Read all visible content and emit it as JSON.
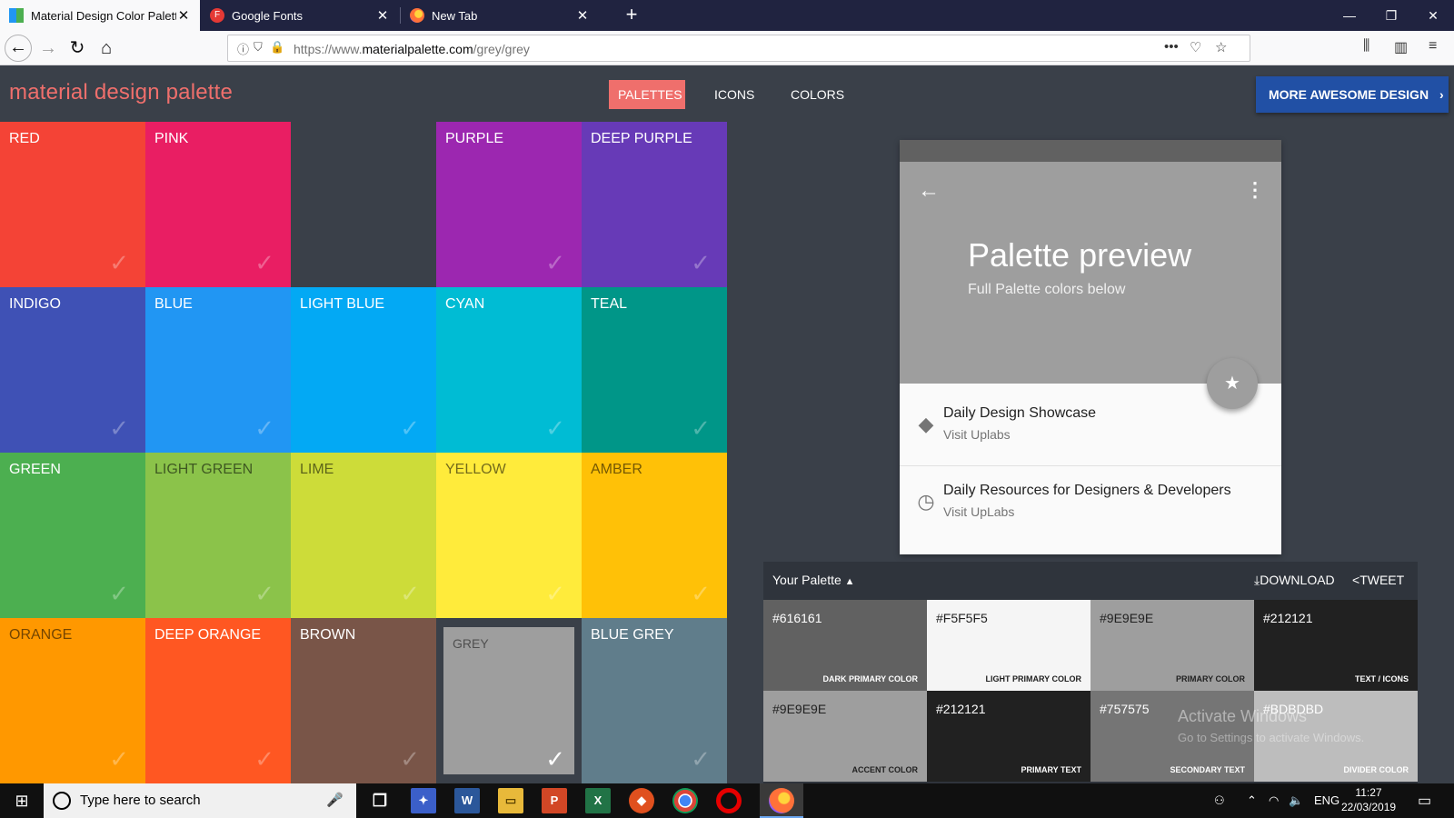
{
  "browser": {
    "tabs": [
      {
        "title": "Material Design Color Palette G",
        "favicon_color": "#2196f3"
      },
      {
        "title": "Google Fonts",
        "favicon_color": "#e53935"
      },
      {
        "title": "New Tab",
        "favicon_color": "#ff7139"
      }
    ],
    "url_prefix": "https://www.",
    "url_host": "materialpalette.com",
    "url_path": "/grey/grey"
  },
  "site": {
    "logo": "material design palette",
    "nav": [
      "PALETTES",
      "ICONS",
      "COLORS"
    ],
    "more_button": "MORE AWESOME DESIGN"
  },
  "colors": [
    {
      "name": "RED",
      "hex": "#f44336",
      "text": "light"
    },
    {
      "name": "PINK",
      "hex": "#e91e63",
      "text": "light"
    },
    {
      "name": "",
      "hex": "#3a4049",
      "text": "light",
      "empty": true
    },
    {
      "name": "PURPLE",
      "hex": "#9c27b0",
      "text": "light"
    },
    {
      "name": "DEEP PURPLE",
      "hex": "#673ab7",
      "text": "light"
    },
    {
      "name": "INDIGO",
      "hex": "#3f51b5",
      "text": "light"
    },
    {
      "name": "BLUE",
      "hex": "#2196f3",
      "text": "light"
    },
    {
      "name": "LIGHT BLUE",
      "hex": "#03a9f4",
      "text": "light"
    },
    {
      "name": "CYAN",
      "hex": "#00bcd4",
      "text": "light"
    },
    {
      "name": "TEAL",
      "hex": "#009688",
      "text": "light"
    },
    {
      "name": "GREEN",
      "hex": "#4caf50",
      "text": "light"
    },
    {
      "name": "LIGHT GREEN",
      "hex": "#8bc34a",
      "text": "dark"
    },
    {
      "name": "LIME",
      "hex": "#cddc39",
      "text": "dark"
    },
    {
      "name": "YELLOW",
      "hex": "#ffeb3b",
      "text": "dark"
    },
    {
      "name": "AMBER",
      "hex": "#ffc107",
      "text": "dark"
    },
    {
      "name": "ORANGE",
      "hex": "#ff9800",
      "text": "dark"
    },
    {
      "name": "DEEP ORANGE",
      "hex": "#ff5722",
      "text": "light"
    },
    {
      "name": "BROWN",
      "hex": "#795548",
      "text": "light"
    },
    {
      "name": "GREY",
      "hex": "#9e9e9e",
      "text": "dark",
      "selected": true
    },
    {
      "name": "BLUE GREY",
      "hex": "#607d8b",
      "text": "light"
    }
  ],
  "preview": {
    "title": "Palette preview",
    "subtitle": "Full Palette colors below",
    "items": [
      {
        "title": "Daily Design Showcase",
        "subtitle": "Visit Uplabs",
        "icon": "label-icon"
      },
      {
        "title": "Daily Resources for Designers & Developers",
        "subtitle": "Visit UpLabs",
        "icon": "clock-icon"
      }
    ]
  },
  "palette": {
    "title": "Your Palette",
    "download": "DOWNLOAD",
    "tweet": "TWEET",
    "cells": [
      {
        "hex": "#616161",
        "role": "DARK PRIMARY COLOR",
        "bg": "#616161",
        "fg": "#ffffff"
      },
      {
        "hex": "#F5F5F5",
        "role": "LIGHT PRIMARY COLOR",
        "bg": "#f5f5f5",
        "fg": "#212121"
      },
      {
        "hex": "#9E9E9E",
        "role": "PRIMARY COLOR",
        "bg": "#9e9e9e",
        "fg": "#212121"
      },
      {
        "hex": "#212121",
        "role": "TEXT / ICONS",
        "bg": "#212121",
        "fg": "#ffffff"
      },
      {
        "hex": "#9E9E9E",
        "role": "ACCENT COLOR",
        "bg": "#9e9e9e",
        "fg": "#212121"
      },
      {
        "hex": "#212121",
        "role": "PRIMARY TEXT",
        "bg": "#212121",
        "fg": "#ffffff"
      },
      {
        "hex": "#757575",
        "role": "SECONDARY TEXT",
        "bg": "#757575",
        "fg": "#ffffff"
      },
      {
        "hex": "#BDBDBD",
        "role": "DIVIDER COLOR",
        "bg": "#bdbdbd",
        "fg": "#ffffff"
      }
    ]
  },
  "watermark": {
    "line1": "Activate Windows",
    "line2": "Go to Settings to activate Windows."
  },
  "taskbar": {
    "search_placeholder": "Type here to search",
    "language": "ENG",
    "time": "11:27",
    "date": "22/03/2019"
  }
}
